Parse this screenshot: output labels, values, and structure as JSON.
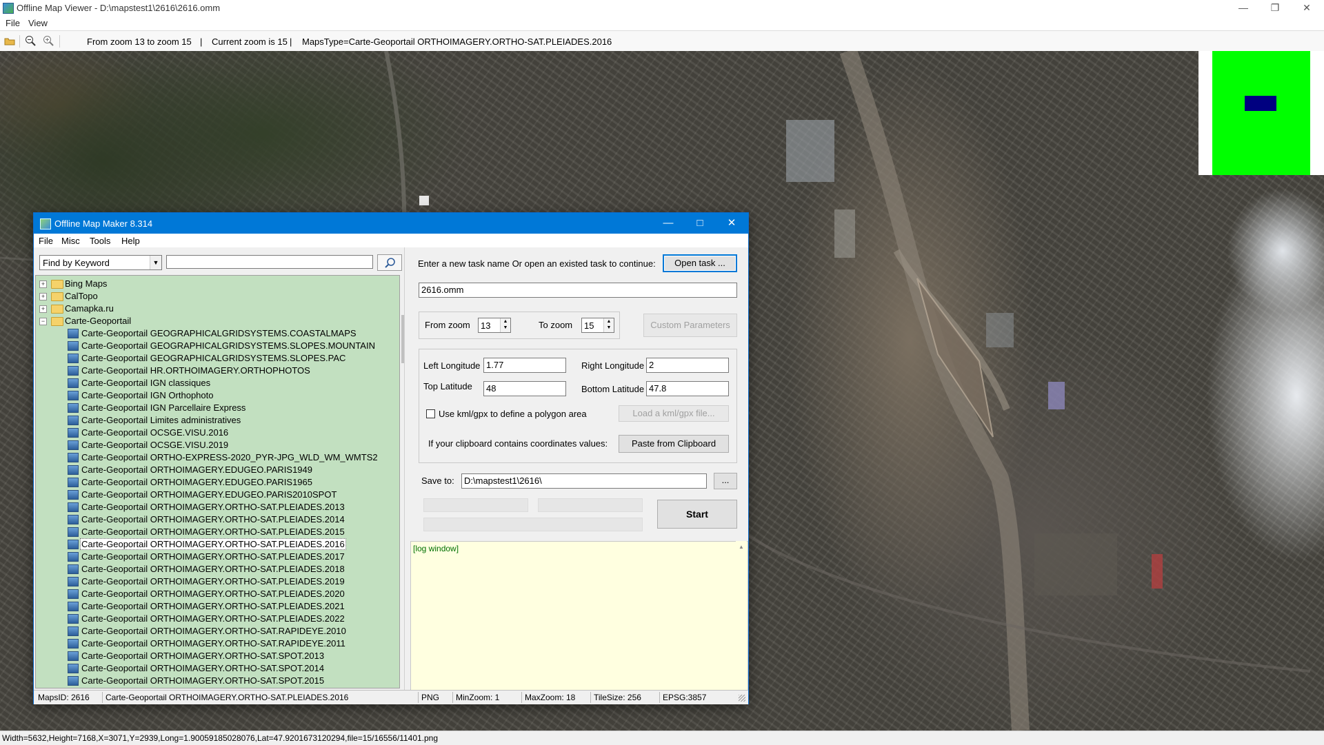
{
  "viewer": {
    "title": "Offline Map Viewer - D:\\mapstest1\\2616\\2616.omm",
    "menu": [
      "File",
      "View"
    ],
    "toolbar": {
      "zoom_range": "From zoom 13 to zoom 15",
      "sep1": "|",
      "current_zoom": "Current zoom is 15",
      "sep2": "|",
      "maps_type": "MapsType=Carte-Geoportail ORTHOIMAGERY.ORTHO-SAT.PLEIADES.2016"
    },
    "status": "Width=5632,Height=7168,X=3071,Y=2939,Long=1.90059185028076,Lat=47.9201673120294,file=15/16556/11401.png",
    "minimap_colors": {
      "background": "#00ff00",
      "viewport": "#000080"
    }
  },
  "dialog": {
    "title": "Offline Map Maker 8.314",
    "menu": [
      "File",
      "Misc",
      "Tools",
      "Help"
    ],
    "search": {
      "mode": "Find by Keyword",
      "query": ""
    },
    "tree": {
      "folders": [
        {
          "label": "Bing Maps",
          "expanded": false
        },
        {
          "label": "CalTopo",
          "expanded": false
        },
        {
          "label": "Camapka.ru",
          "expanded": false
        },
        {
          "label": "Carte-Geoportail",
          "expanded": true
        }
      ],
      "items": [
        "Carte-Geoportail GEOGRAPHICALGRIDSYSTEMS.COASTALMAPS",
        "Carte-Geoportail GEOGRAPHICALGRIDSYSTEMS.SLOPES.MOUNTAIN",
        "Carte-Geoportail GEOGRAPHICALGRIDSYSTEMS.SLOPES.PAC",
        "Carte-Geoportail HR.ORTHOIMAGERY.ORTHOPHOTOS",
        "Carte-Geoportail IGN classiques",
        "Carte-Geoportail IGN Orthophoto",
        "Carte-Geoportail IGN Parcellaire Express",
        "Carte-Geoportail Limites administratives",
        "Carte-Geoportail OCSGE.VISU.2016",
        "Carte-Geoportail OCSGE.VISU.2019",
        "Carte-Geoportail ORTHO-EXPRESS-2020_PYR-JPG_WLD_WM_WMTS2",
        "Carte-Geoportail ORTHOIMAGERY.EDUGEO.PARIS1949",
        "Carte-Geoportail ORTHOIMAGERY.EDUGEO.PARIS1965",
        "Carte-Geoportail ORTHOIMAGERY.EDUGEO.PARIS2010SPOT",
        "Carte-Geoportail ORTHOIMAGERY.ORTHO-SAT.PLEIADES.2013",
        "Carte-Geoportail ORTHOIMAGERY.ORTHO-SAT.PLEIADES.2014",
        "Carte-Geoportail ORTHOIMAGERY.ORTHO-SAT.PLEIADES.2015",
        "Carte-Geoportail ORTHOIMAGERY.ORTHO-SAT.PLEIADES.2016",
        "Carte-Geoportail ORTHOIMAGERY.ORTHO-SAT.PLEIADES.2017",
        "Carte-Geoportail ORTHOIMAGERY.ORTHO-SAT.PLEIADES.2018",
        "Carte-Geoportail ORTHOIMAGERY.ORTHO-SAT.PLEIADES.2019",
        "Carte-Geoportail ORTHOIMAGERY.ORTHO-SAT.PLEIADES.2020",
        "Carte-Geoportail ORTHOIMAGERY.ORTHO-SAT.PLEIADES.2021",
        "Carte-Geoportail ORTHOIMAGERY.ORTHO-SAT.PLEIADES.2022",
        "Carte-Geoportail ORTHOIMAGERY.ORTHO-SAT.RAPIDEYE.2010",
        "Carte-Geoportail ORTHOIMAGERY.ORTHO-SAT.RAPIDEYE.2011",
        "Carte-Geoportail ORTHOIMAGERY.ORTHO-SAT.SPOT.2013",
        "Carte-Geoportail ORTHOIMAGERY.ORTHO-SAT.SPOT.2014",
        "Carte-Geoportail ORTHOIMAGERY.ORTHO-SAT.SPOT.2015"
      ],
      "selected_index": 17
    },
    "task": {
      "prompt": "Enter a new task name Or open an existed task to continue:",
      "open_button": "Open task ...",
      "name": "2616.omm"
    },
    "zoom": {
      "from_label": "From zoom",
      "from_value": "13",
      "to_label": "To zoom",
      "to_value": "15",
      "custom_button": "Custom Parameters"
    },
    "area": {
      "left_lon_label": "Left Longitude",
      "left_lon": "1.77",
      "right_lon_label": "Right Longitude",
      "right_lon": "2",
      "top_lat_label": "Top Latitude",
      "top_lat": "48",
      "bottom_lat_label": "Bottom Latitude",
      "bottom_lat": "47.8",
      "kml_checkbox_label": "Use kml/gpx to define a polygon area",
      "kml_checked": false,
      "kml_button": "Load a kml/gpx file...",
      "clipboard_label": "If your clipboard contains coordinates values:",
      "clipboard_button": "Paste from Clipboard"
    },
    "save": {
      "label": "Save to:",
      "path": "D:\\mapstest1\\2616\\",
      "browse_button": "..."
    },
    "start_button": "Start",
    "log": "[log window]",
    "status": {
      "maps_id": "MapsID: 2616",
      "map_name": "Carte-Geoportail ORTHOIMAGERY.ORTHO-SAT.PLEIADES.2016",
      "format": "PNG",
      "min_zoom": "MinZoom: 1",
      "max_zoom": "MaxZoom: 18",
      "tile_size": "TileSize: 256",
      "epsg": "EPSG:3857"
    }
  }
}
